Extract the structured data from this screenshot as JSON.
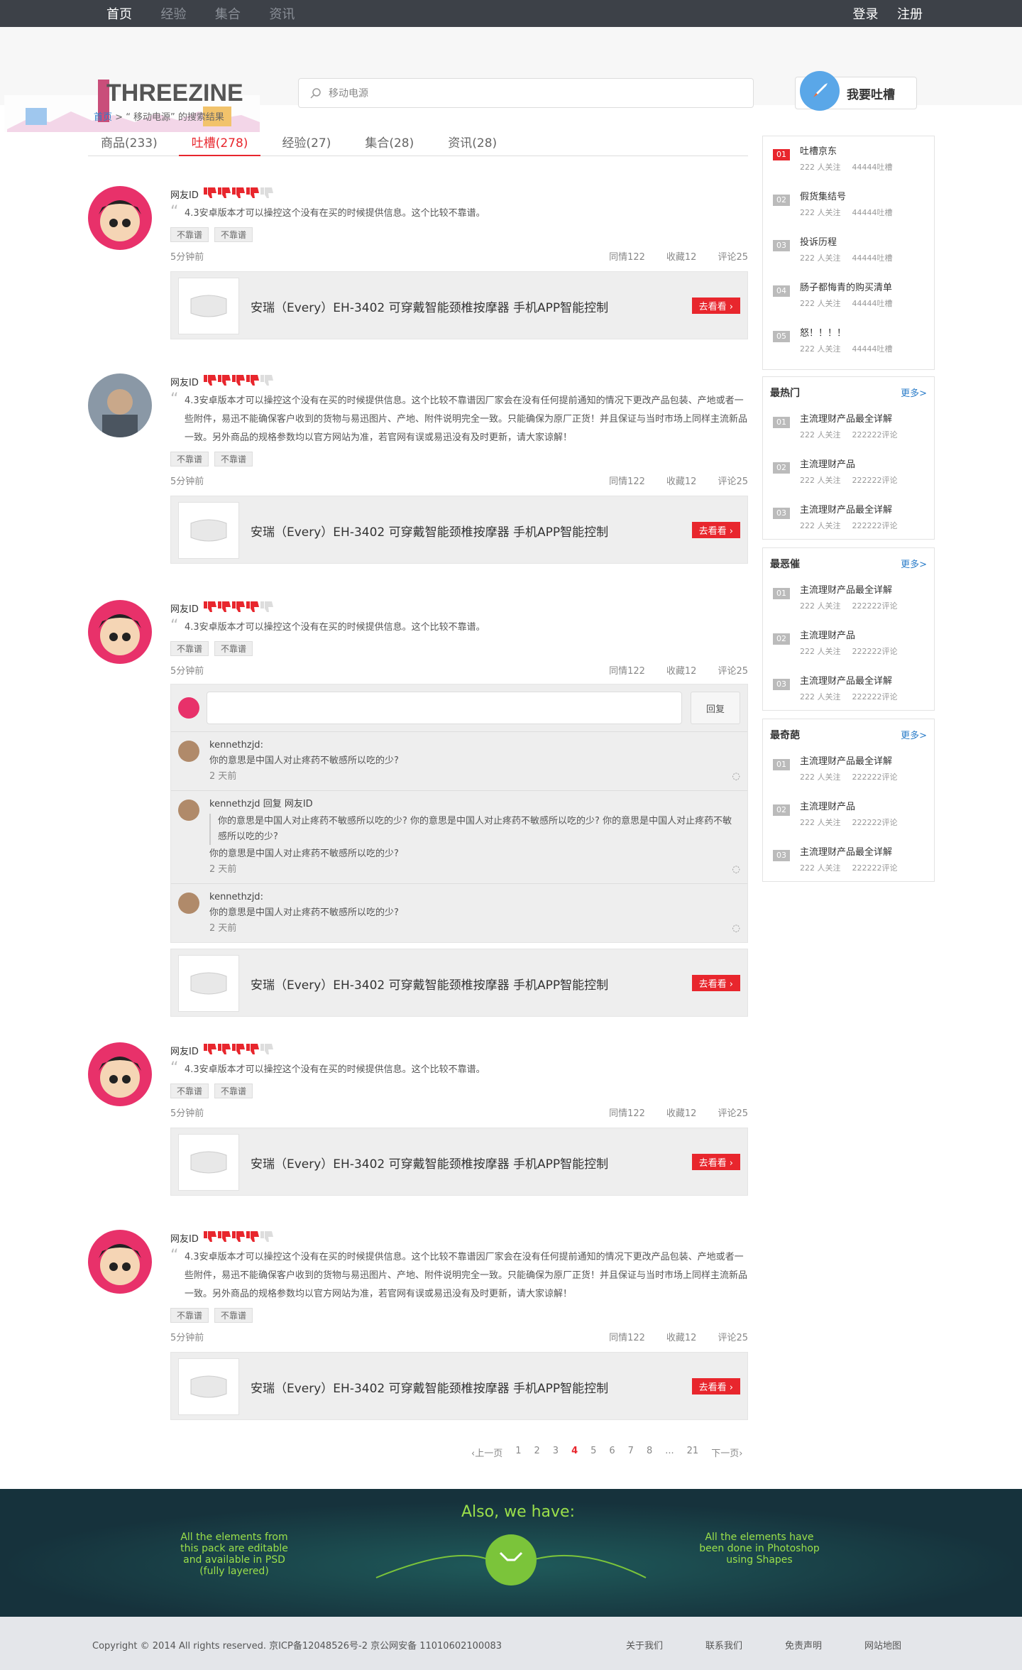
{
  "topnav": {
    "items": [
      "首页",
      "经验",
      "集合",
      "资讯"
    ],
    "login": "登录",
    "register": "注册"
  },
  "header": {
    "logo_text": "THREEZINE",
    "search_value": "移动电源",
    "tucao_label": "我要吐槽"
  },
  "breadcrumb": {
    "home": "首页",
    "sep": " > ",
    "current": "“ 移动电源” 的搜索结果"
  },
  "tabs": [
    "商品(233)",
    "吐槽(278)",
    "经验(27)",
    "集合(28)",
    "资讯(28)"
  ],
  "post_common": {
    "user": "网友ID",
    "short_text": "4.3安卓版本才可以操控这个没有在买的时候提供信息。这个比较不靠谱。",
    "long_text": "4.3安卓版本才可以操控这个没有在买的时候提供信息。这个比较不靠谱因厂家会在没有任何提前通知的情况下更改产品包装、产地或者一些附件，易迅不能确保客户收到的货物与易迅图片、产地、附件说明完全一致。只能确保为原厂正货！并且保证与当时市场上同样主流新品一致。另外商品的规格参数均以官方网站为准，若官网有误或易迅没有及时更新，请大家谅解！",
    "tag1": "不靠谱",
    "tag2": "不靠谱",
    "time": "5分钟前",
    "like": "同情122",
    "fav": "收藏12",
    "cmt": "评论25",
    "product": "安瑞（Every）EH-3402 可穿戴智能颈椎按摩器 手机APP智能控制",
    "go": "去看看"
  },
  "comments": {
    "reply_btn": "回复",
    "c1_name": "kennethzjd:",
    "c1_text": "你的意思是中国人对止疼药不敏感所以吃的少?",
    "c1_time": "2 天前",
    "c2_name": "kennethzjd  回复  网友ID",
    "c2_quote": "你的意思是中国人对止疼药不敏感所以吃的少? 你的意思是中国人对止疼药不敏感所以吃的少? 你的意思是中国人对止疼药不敏感所以吃的少?",
    "c2_text": "你的意思是中国人对止疼药不敏感所以吃的少?",
    "c2_time": "2 天前",
    "c3_name": "kennethzjd:",
    "c3_text": "你的意思是中国人对止疼药不敏感所以吃的少?",
    "c3_time": "2 天前"
  },
  "rank": {
    "items": [
      {
        "n": "01",
        "t": "吐槽京东"
      },
      {
        "n": "02",
        "t": "假货集结号"
      },
      {
        "n": "03",
        "t": "投诉历程"
      },
      {
        "n": "04",
        "t": "肠子都悔青的购买清单"
      },
      {
        "n": "05",
        "t": "怒！！！！"
      }
    ],
    "follow": "222 人关注",
    "count": "44444吐槽"
  },
  "side_boxes": [
    {
      "title": "最热门",
      "more": "更多>",
      "items": [
        "主流理财产品最全详解",
        "主流理财产品",
        "主流理财产品最全详解"
      ]
    },
    {
      "title": "最恶催",
      "more": "更多>",
      "items": [
        "主流理财产品最全详解",
        "主流理财产品",
        "主流理财产品最全详解"
      ]
    },
    {
      "title": "最奇葩",
      "more": "更多>",
      "items": [
        "主流理财产品最全详解",
        "主流理财产品",
        "主流理财产品最全详解"
      ]
    }
  ],
  "side_meta": {
    "follow": "222 人关注",
    "cmt": "222222评论",
    "nums": [
      "01",
      "02",
      "03"
    ]
  },
  "pager": {
    "prev": "上一页",
    "pages": [
      "1",
      "2",
      "3",
      "4",
      "5",
      "6",
      "7",
      "8",
      "...",
      "21"
    ],
    "next": "下一页",
    "current": "4"
  },
  "banner": {
    "title": "Also, we have:",
    "left": "All the elements from this pack are editable and available in PSD (fully layered)",
    "right": "All the elements have been done in Photoshop using Shapes"
  },
  "footer": {
    "copy": "Copyright © 2014 All rights reserved. 京ICP备12048526号-2 京公网安备 11010602100083",
    "links": [
      "关于我们",
      "联系我们",
      "免责声明",
      "网站地图"
    ]
  }
}
